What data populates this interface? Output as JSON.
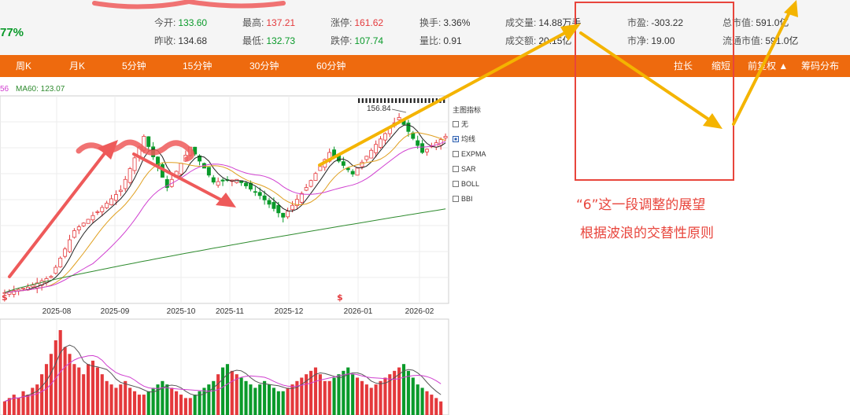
{
  "header": {
    "change_pct": "77%",
    "stats": [
      {
        "label": "今开:",
        "value": "133.60",
        "color": "#0a9a2a"
      },
      {
        "label": "最高:",
        "value": "137.21",
        "color": "#e4393c"
      },
      {
        "label": "涨停:",
        "value": "161.62",
        "color": "#e4393c"
      },
      {
        "label": "换手:",
        "value": "3.36%",
        "color": "#333333"
      },
      {
        "label": "成交量:",
        "value": "14.88万手",
        "color": "#333333"
      },
      {
        "label": "市盈:",
        "value": "-303.22",
        "color": "#333333"
      },
      {
        "label": "总市值:",
        "value": "591.0亿",
        "color": "#333333"
      },
      {
        "label": "昨收:",
        "value": "134.68",
        "color": "#333333"
      },
      {
        "label": "最低:",
        "value": "132.73",
        "color": "#0a9a2a"
      },
      {
        "label": "跌停:",
        "value": "107.74",
        "color": "#0a9a2a"
      },
      {
        "label": "量比:",
        "value": "0.91",
        "color": "#333333"
      },
      {
        "label": "成交额:",
        "value": "20.15亿",
        "color": "#333333"
      },
      {
        "label": "市净:",
        "value": "19.00",
        "color": "#333333"
      },
      {
        "label": "流通市值:",
        "value": "591.0亿",
        "color": "#333333"
      }
    ]
  },
  "toolbar": {
    "tabs": [
      "周K",
      "月K",
      "5分钟",
      "15分钟",
      "30分钟",
      "60分钟"
    ],
    "right_tabs": [
      "拉长",
      "缩短",
      "前复权 ▲",
      "筹码分布"
    ]
  },
  "ma_legend": {
    "prefix": "56",
    "ma60": "MA60: 123.07",
    "ma60_color": "#2e8b2e"
  },
  "indicator_panel": {
    "title": "主图指标",
    "options": [
      {
        "label": "无",
        "checked": false
      },
      {
        "label": "均线",
        "checked": true
      },
      {
        "label": "EXPMA",
        "checked": false
      },
      {
        "label": "SAR",
        "checked": false
      },
      {
        "label": "BOLL",
        "checked": false
      },
      {
        "label": "BBI",
        "checked": false
      }
    ]
  },
  "chart_data": {
    "type": "candlestick",
    "x_ticks": [
      "2025-08",
      "2025-09",
      "2025-10",
      "2025-11",
      "2025-12",
      "2026-01",
      "2026-02"
    ],
    "price_range": [
      88,
      165
    ],
    "peak_label": "156.84",
    "series": [
      {
        "name": "MA60",
        "value_last": 123.07
      }
    ],
    "candles_close": [
      92,
      92.4,
      92.8,
      93.2,
      93.6,
      94,
      94.8,
      95.6,
      96.4,
      97.2,
      98,
      101.4,
      104.8,
      108.2,
      111.6,
      115,
      116.4,
      117.8,
      119.2,
      120.6,
      122,
      123.6,
      125.2,
      126.8,
      128.4,
      130,
      134,
      138,
      142,
      146,
      150,
      146.2,
      142.4,
      138.6,
      134.8,
      131,
      134,
      137,
      140,
      143,
      146,
      143.4,
      140.8,
      138.2,
      135.6,
      133,
      133.2,
      133.4,
      133.6,
      133.8,
      134,
      132.8,
      131.6,
      130.4,
      129.2,
      128,
      126.4,
      124.8,
      123.2,
      121.6,
      120,
      122.2,
      124.4,
      126.6,
      128.8,
      131,
      133.6,
      136.2,
      138.8,
      141.4,
      144,
      142.4,
      140.8,
      139.2,
      137.6,
      136,
      138.2,
      140.4,
      142.6,
      144.8,
      147,
      149,
      151,
      153,
      155,
      157,
      154.4,
      151.8,
      149.2,
      146.6,
      144,
      145.2,
      146.4,
      147.6,
      148.8,
      150
    ],
    "volume": [
      4,
      5,
      6,
      5,
      7,
      6,
      8,
      9,
      12,
      15,
      18,
      22,
      25,
      20,
      18,
      15,
      14,
      12,
      15,
      16,
      14,
      12,
      10,
      9,
      8,
      9,
      10,
      8,
      7,
      6,
      6,
      7,
      8,
      9,
      10,
      9,
      8,
      7,
      6,
      5,
      5,
      6,
      7,
      8,
      9,
      10,
      12,
      14,
      15,
      13,
      12,
      11,
      10,
      9,
      8,
      9,
      10,
      9,
      8,
      7,
      7,
      8,
      9,
      10,
      11,
      12,
      13,
      14,
      12,
      10,
      10,
      11,
      12,
      13,
      14,
      12,
      11,
      10,
      9,
      8,
      9,
      10,
      11,
      12,
      13,
      14,
      15,
      13,
      11,
      9,
      8,
      7,
      6,
      5,
      4
    ]
  },
  "annotations": {
    "line1": "“6”这一段调整的展望",
    "line2": "根据波浪的交替性原则",
    "dollar_signs": [
      "$",
      "$"
    ]
  }
}
